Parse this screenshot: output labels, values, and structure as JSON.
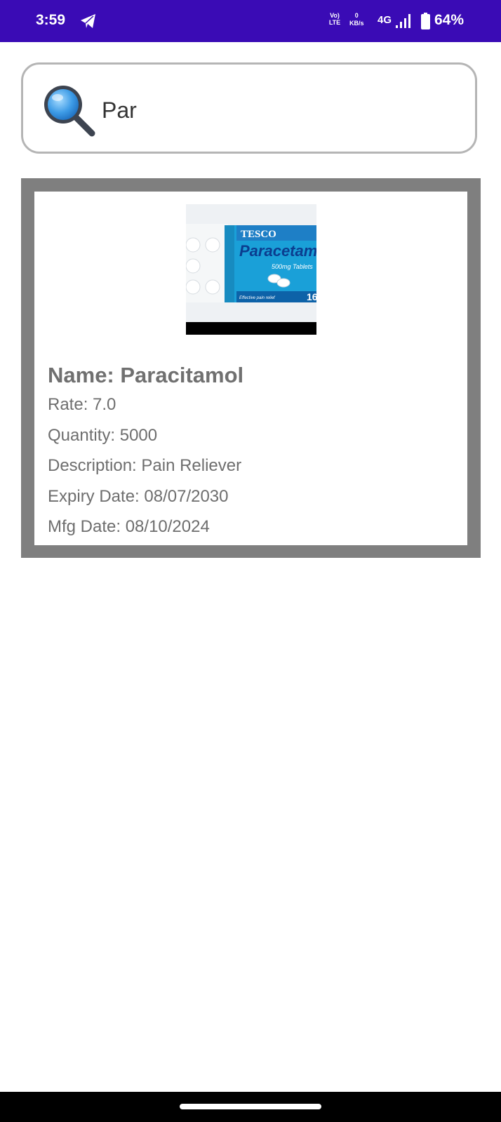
{
  "status_bar": {
    "time": "3:59",
    "volte_label": "Vo) LTE",
    "speed_value": "0",
    "speed_unit": "KB/s",
    "network_type": "4G",
    "battery_percent": "64%",
    "background_color": "#3a0bb5",
    "icons": [
      "telegram-icon",
      "signal-bars-icon",
      "battery-icon"
    ]
  },
  "search": {
    "value": "Par",
    "icon": "magnifying-glass-icon"
  },
  "results": [
    {
      "image_label": {
        "brand": "TESCO",
        "product": "Paracetamol",
        "strength": "500mg Tablets",
        "tagline": "Effective pain relief",
        "count": "16"
      },
      "name": "Name: Paracitamol",
      "rate": "Rate: 7.0",
      "quantity": "Quantity: 5000",
      "description": "Description: Pain Reliever",
      "expiry": "Expiry Date: 08/07/2030",
      "mfg": "Mfg Date: 08/10/2024"
    }
  ]
}
